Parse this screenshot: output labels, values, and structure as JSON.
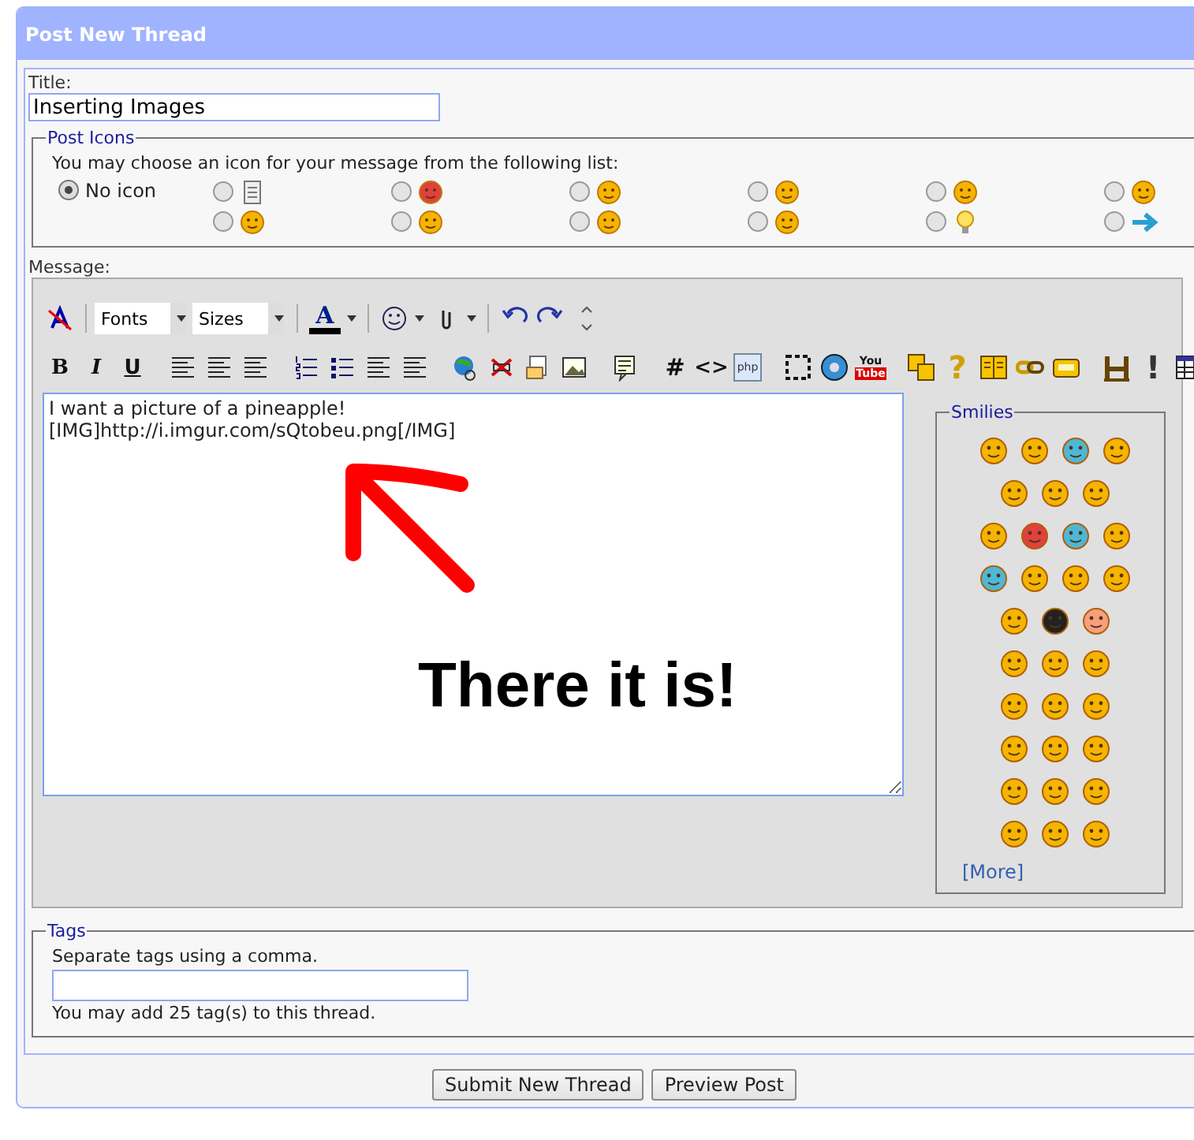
{
  "header": {
    "title": "Post New Thread"
  },
  "title_field": {
    "label": "Title:",
    "value": "Inserting Images"
  },
  "post_icons": {
    "legend": "Post Icons",
    "prompt": "You may choose an icon for your message from the following list:",
    "options": [
      {
        "kind": "none",
        "label": "No icon",
        "selected": true
      },
      {
        "kind": "note",
        "selected": false
      },
      {
        "kind": "angry",
        "selected": false
      },
      {
        "kind": "wink",
        "selected": false
      },
      {
        "kind": "sad",
        "selected": false
      },
      {
        "kind": "grin",
        "selected": false
      },
      {
        "kind": "cry",
        "selected": false
      },
      {
        "kind": "smile",
        "selected": false
      },
      {
        "kind": "cool",
        "selected": false
      },
      {
        "kind": "question",
        "selected": false
      },
      {
        "kind": "shock",
        "selected": false
      },
      {
        "kind": "bulb",
        "selected": false
      },
      {
        "kind": "arrow",
        "selected": false
      }
    ]
  },
  "message": {
    "label": "Message:",
    "toolbar_rows": [
      [
        {
          "kind": "remove-format"
        },
        {
          "kind": "sep"
        },
        {
          "kind": "select",
          "label": "Fonts"
        },
        {
          "kind": "select",
          "label": "Sizes"
        },
        {
          "kind": "sep"
        },
        {
          "kind": "font-color",
          "glyph": "A"
        },
        {
          "kind": "sep"
        },
        {
          "kind": "smiley-menu"
        },
        {
          "kind": "attach"
        },
        {
          "kind": "sep"
        },
        {
          "kind": "undo"
        },
        {
          "kind": "redo"
        },
        {
          "kind": "resize"
        }
      ],
      [
        {
          "kind": "bold",
          "glyph": "B"
        },
        {
          "kind": "italic",
          "glyph": "I"
        },
        {
          "kind": "underline",
          "glyph": "U"
        },
        {
          "kind": "sep"
        },
        {
          "kind": "align-left"
        },
        {
          "kind": "align-center"
        },
        {
          "kind": "align-right"
        },
        {
          "kind": "sep"
        },
        {
          "kind": "ordered-list"
        },
        {
          "kind": "bullet-list"
        },
        {
          "kind": "outdent"
        },
        {
          "kind": "indent"
        },
        {
          "kind": "sep"
        },
        {
          "kind": "link"
        },
        {
          "kind": "unlink"
        },
        {
          "kind": "email"
        },
        {
          "kind": "image"
        },
        {
          "kind": "sep"
        },
        {
          "kind": "quote"
        },
        {
          "kind": "sep"
        },
        {
          "kind": "code",
          "glyph": "#"
        },
        {
          "kind": "html",
          "glyph": "<>"
        },
        {
          "kind": "php",
          "glyph": "php"
        },
        {
          "kind": "sep"
        },
        {
          "kind": "dashed-box"
        },
        {
          "kind": "audio"
        },
        {
          "kind": "youtube",
          "glyph": "You",
          "glyph2": "Tube"
        },
        {
          "kind": "sep"
        },
        {
          "kind": "boxes"
        },
        {
          "kind": "help",
          "glyph": "?"
        },
        {
          "kind": "book"
        },
        {
          "kind": "chain"
        },
        {
          "kind": "card"
        },
        {
          "kind": "sep"
        },
        {
          "kind": "film"
        },
        {
          "kind": "alert",
          "glyph": "!"
        },
        {
          "kind": "table"
        }
      ]
    ],
    "lines": [
      "I want a picture of a pineapple!",
      "[IMG]http://i.imgur.com/sQtobeu.png[/IMG]"
    ],
    "annotation": "There it is!",
    "smilies": {
      "legend": "Smilies",
      "rows": [
        [
          {
            "color": "#f5b400"
          },
          {
            "color": "#f5b400"
          },
          {
            "color": "#4cb8d8"
          },
          {
            "color": "#f5b400"
          }
        ],
        [
          {
            "color": "#f5b400"
          },
          {
            "color": "#f5b400"
          },
          {
            "color": "#f5b400"
          }
        ],
        [
          {
            "color": "#f5b400"
          },
          {
            "color": "#e04040"
          },
          {
            "color": "#4cb8d8"
          },
          {
            "color": "#f5b400"
          }
        ],
        [
          {
            "color": "#4cb8d8"
          },
          {
            "color": "#f5b400"
          },
          {
            "color": "#f5b400"
          },
          {
            "color": "#f5b400"
          }
        ],
        [
          {
            "color": "#f5b400"
          },
          {
            "color": "#222222"
          },
          {
            "color": "#f7a080"
          }
        ],
        [
          {
            "color": "#f5b400"
          },
          {
            "color": "#f5b400"
          },
          {
            "color": "#f5b400"
          }
        ],
        [
          {
            "color": "#f5b400"
          },
          {
            "color": "#f5b400"
          },
          {
            "color": "#f5b400"
          }
        ],
        [
          {
            "color": "#f5b400"
          },
          {
            "color": "#f5b400"
          },
          {
            "color": "#f5b400"
          }
        ],
        [
          {
            "color": "#f5b400"
          },
          {
            "color": "#f5b400"
          },
          {
            "color": "#f5b400"
          }
        ],
        [
          {
            "color": "#f5b400"
          },
          {
            "color": "#f5b400"
          },
          {
            "color": "#f5b400"
          }
        ]
      ],
      "more": "[More]"
    }
  },
  "tags": {
    "legend": "Tags",
    "hint": "Separate tags using a comma.",
    "note": "You may add 25 tag(s) to this thread."
  },
  "buttons": [
    "Submit New Thread",
    "Preview Post"
  ]
}
